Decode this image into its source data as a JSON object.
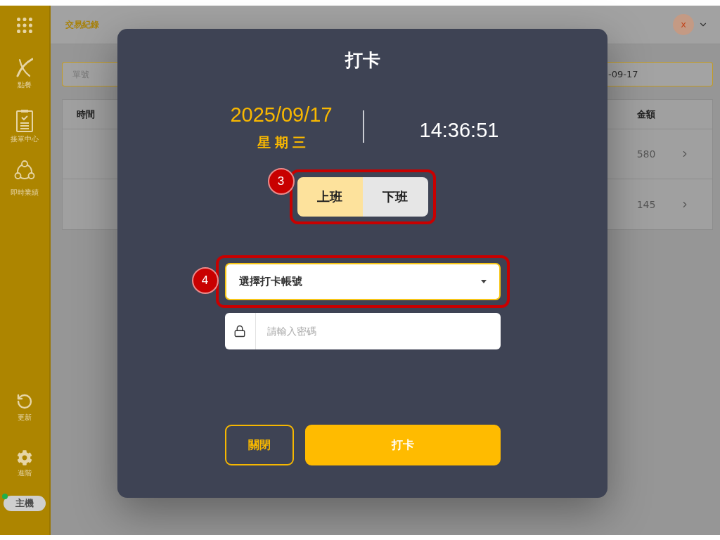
{
  "sidebar": {
    "items": [
      {
        "label": "點餐",
        "kind": "logo"
      },
      {
        "label": "接單中心",
        "kind": "clipboard"
      },
      {
        "label": "即時業績",
        "kind": "network"
      }
    ],
    "bottom_items": [
      {
        "label": "更新",
        "kind": "refresh"
      },
      {
        "label": "進階",
        "kind": "gear"
      }
    ],
    "host_status": {
      "label": "主機",
      "online": true
    }
  },
  "header": {
    "title": "交易紀錄",
    "avatar_letter": "x"
  },
  "filters": {
    "order_number": {
      "placeholder": "單號"
    },
    "date": {
      "value": "-09-17"
    }
  },
  "table": {
    "columns": [
      {
        "label": "時間"
      },
      {
        "label": "金額"
      }
    ],
    "rows": [
      {
        "amount": "580"
      },
      {
        "amount": "145"
      }
    ]
  },
  "dialog": {
    "title": "打卡",
    "date": "2025/09/17",
    "weekday": "星期三",
    "time": "14:36:51",
    "shift_selector": {
      "callout": "3",
      "options": [
        {
          "label": "上班",
          "selected": true
        },
        {
          "label": "下班",
          "selected": false
        }
      ]
    },
    "account_select": {
      "placeholder": "選擇打卡帳號",
      "callout": "4"
    },
    "password": {
      "placeholder": "請輸入密碼"
    },
    "buttons": [
      {
        "label": "關閉",
        "kind": "secondary"
      },
      {
        "label": "打卡",
        "kind": "primary"
      }
    ]
  }
}
